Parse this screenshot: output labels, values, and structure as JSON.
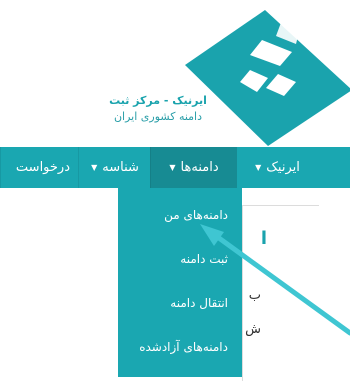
{
  "brand": {
    "title": "ایرنیک - مرکز ثبت",
    "subtitle": "دامنه کشوری ایران",
    "colors": {
      "teal": "#1aa7b1",
      "teal_dark": "#178b93"
    }
  },
  "nav": {
    "items": [
      {
        "label": "ایرنیک",
        "has_caret": true,
        "active": false
      },
      {
        "label": "دامنه‌ها",
        "has_caret": true,
        "active": true
      },
      {
        "label": "شناسه",
        "has_caret": true,
        "active": false
      },
      {
        "label": "درخواست",
        "has_caret": false,
        "active": false
      }
    ],
    "caret_icon": "caret-down-icon"
  },
  "dropdown": {
    "items": [
      {
        "label": "دامنه‌های من"
      },
      {
        "label": "ثبت دامنه"
      },
      {
        "label": "انتقال دامنه"
      },
      {
        "label": "دامنه‌های آزادشده"
      }
    ]
  },
  "content": {
    "heading_fragment": "ا",
    "line1_fragment": "ب",
    "line2_fragment": "ش"
  },
  "annotation": {
    "icon": "pointer-arrow-icon",
    "color": "#3fc6d2"
  }
}
